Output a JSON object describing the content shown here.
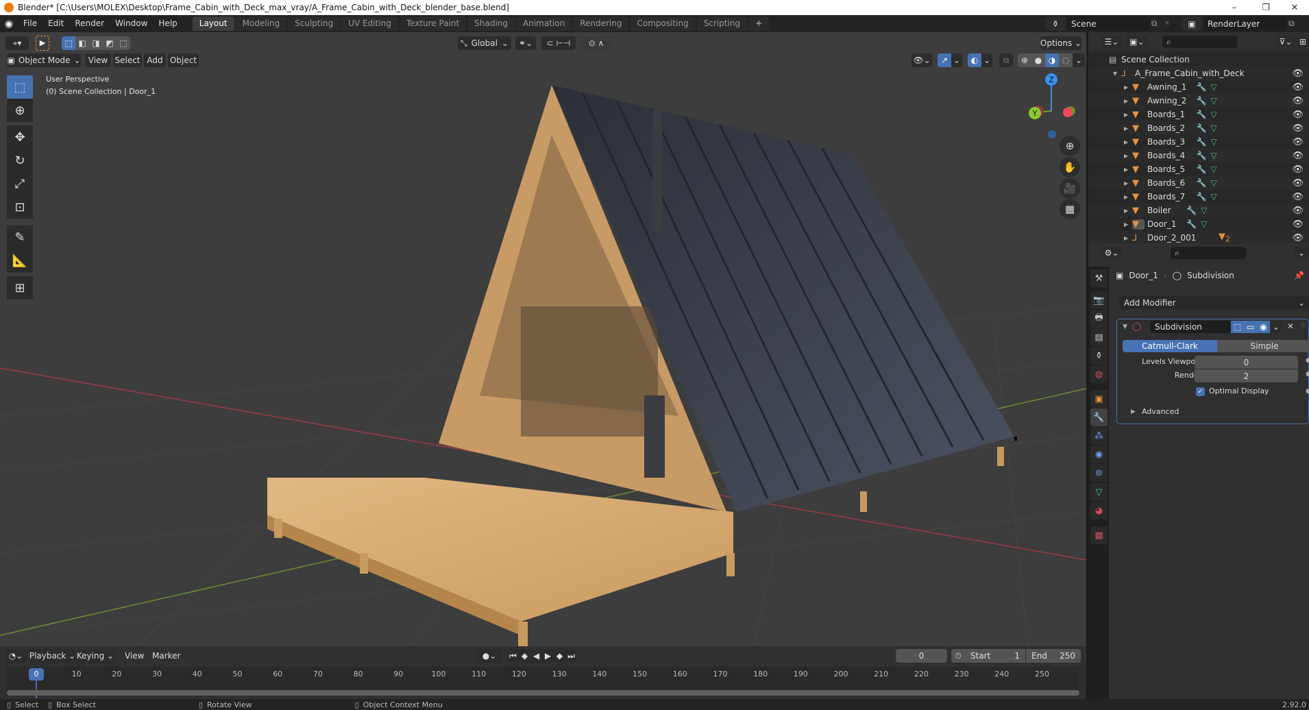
{
  "window": {
    "title": "Blender* [C:\\Users\\MOLEX\\Desktop\\Frame_Cabin_with_Deck_max_vray/A_Frame_Cabin_with_Deck_blender_base.blend]",
    "controls": {
      "minimize": "–",
      "restore": "❐",
      "close": "✕"
    }
  },
  "top_menu": {
    "items": [
      "File",
      "Edit",
      "Render",
      "Window",
      "Help"
    ],
    "workspaces": [
      "Layout",
      "Modeling",
      "Sculpting",
      "UV Editing",
      "Texture Paint",
      "Shading",
      "Animation",
      "Rendering",
      "Compositing",
      "Scripting"
    ],
    "active_workspace": "Layout",
    "add_workspace": "+",
    "scene": "Scene",
    "view_layer": "RenderLayer"
  },
  "tool_header": {
    "transform_orientation": "Global",
    "options_label": "Options"
  },
  "viewport_header": {
    "mode": "Object Mode",
    "menus": [
      "View",
      "Select",
      "Add",
      "Object"
    ]
  },
  "viewport": {
    "perspective_label": "User Perspective",
    "collection_label": "(0) Scene Collection | Door_1",
    "gizmo_axes": {
      "z": "Z",
      "y": "Y"
    },
    "colors": {
      "x_axis": "#c74b5c",
      "y_axis": "#7aa336",
      "z_axis": "#3b8ef0",
      "active": "#4772b3"
    }
  },
  "outliner": {
    "root": "Scene Collection",
    "collection": "A_Frame_Cabin_with_Deck",
    "items": [
      {
        "name": "Awning_1",
        "modifier": true,
        "mesh": true
      },
      {
        "name": "Awning_2",
        "modifier": true,
        "mesh": true
      },
      {
        "name": "Boards_1",
        "modifier": true,
        "mesh": true
      },
      {
        "name": "Boards_2",
        "modifier": true,
        "mesh": true
      },
      {
        "name": "Boards_3",
        "modifier": true,
        "mesh": true
      },
      {
        "name": "Boards_4",
        "modifier": true,
        "mesh": true
      },
      {
        "name": "Boards_5",
        "modifier": true,
        "mesh": true
      },
      {
        "name": "Boards_6",
        "modifier": true,
        "mesh": true
      },
      {
        "name": "Boards_7",
        "modifier": true,
        "mesh": true
      },
      {
        "name": "Boiler",
        "modifier": true,
        "mesh": true
      },
      {
        "name": "Door_1",
        "modifier": true,
        "mesh": true,
        "selected": true
      },
      {
        "name": "Door_2_001",
        "empty": true,
        "children_count": "2"
      }
    ]
  },
  "properties": {
    "breadcrumb_object": "Door_1",
    "breadcrumb_modifier": "Subdivision",
    "add_modifier_label": "Add Modifier",
    "modifier": {
      "name": "Subdivision",
      "type_options": [
        "Catmull-Clark",
        "Simple"
      ],
      "selected_type": "Catmull-Clark",
      "levels_viewport_label": "Levels Viewport",
      "levels_viewport": "0",
      "render_label": "Render",
      "render": "2",
      "optimal_display_label": "Optimal Display",
      "optimal_display": true,
      "advanced_label": "Advanced"
    }
  },
  "timeline": {
    "menus": [
      "Playback",
      "Keying",
      "View",
      "Marker"
    ],
    "current_frame": "0",
    "start_label": "Start",
    "start": "1",
    "end_label": "End",
    "end": "250",
    "ticks": [
      "0",
      "10",
      "20",
      "30",
      "40",
      "50",
      "60",
      "70",
      "80",
      "90",
      "100",
      "110",
      "120",
      "130",
      "140",
      "150",
      "160",
      "170",
      "180",
      "190",
      "200",
      "210",
      "220",
      "230",
      "240",
      "250"
    ]
  },
  "statusbar": {
    "select": "Select",
    "box_select": "Box Select",
    "rotate_view": "Rotate View",
    "context_menu": "Object Context Menu",
    "version": "2.92.0"
  }
}
